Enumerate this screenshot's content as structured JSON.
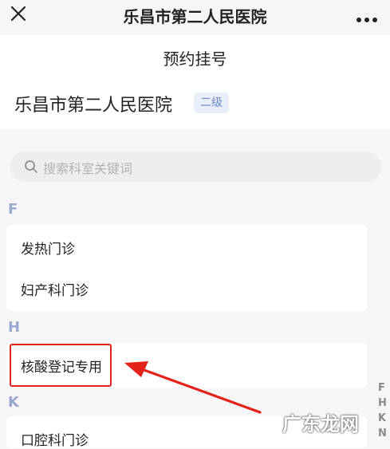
{
  "window": {
    "title": "乐昌市第二人民医院"
  },
  "header": {
    "page_title": "预约挂号",
    "hospital_name": "乐昌市第二人民医院",
    "level": "二级"
  },
  "search": {
    "placeholder": "搜索科室关键词"
  },
  "sections": [
    {
      "letter": "F",
      "items": [
        "发热门诊",
        "妇产科门诊"
      ]
    },
    {
      "letter": "H",
      "items": [
        "核酸登记专用"
      ]
    },
    {
      "letter": "K",
      "items": [
        "口腔科门诊"
      ]
    }
  ],
  "index_bar": [
    "F",
    "H",
    "K",
    "N"
  ],
  "annotation": {
    "highlight_color": "#e3231a"
  },
  "watermark": "广东龙网",
  "icons": {
    "close": "close-icon",
    "more": "more-icon",
    "search": "search-icon",
    "arrow": "arrow-icon"
  }
}
